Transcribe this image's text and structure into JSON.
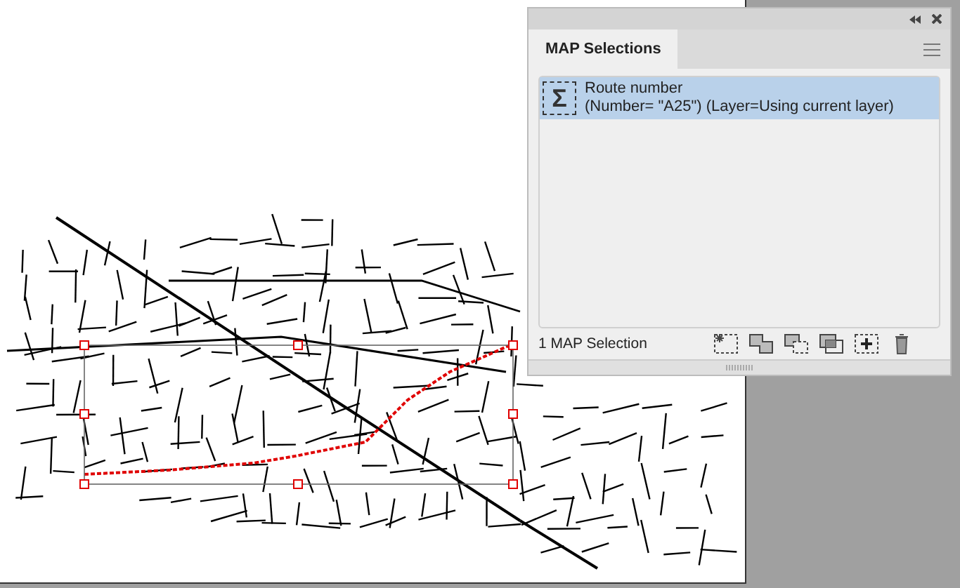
{
  "panel": {
    "tab": {
      "label": "MAP Selections",
      "selected": true
    },
    "items": [
      {
        "icon": "Σ",
        "title": "Route number",
        "detail": "(Number= \"A25\") (Layer=Using current layer)",
        "selected": true
      }
    ],
    "status": "1 MAP Selection"
  }
}
